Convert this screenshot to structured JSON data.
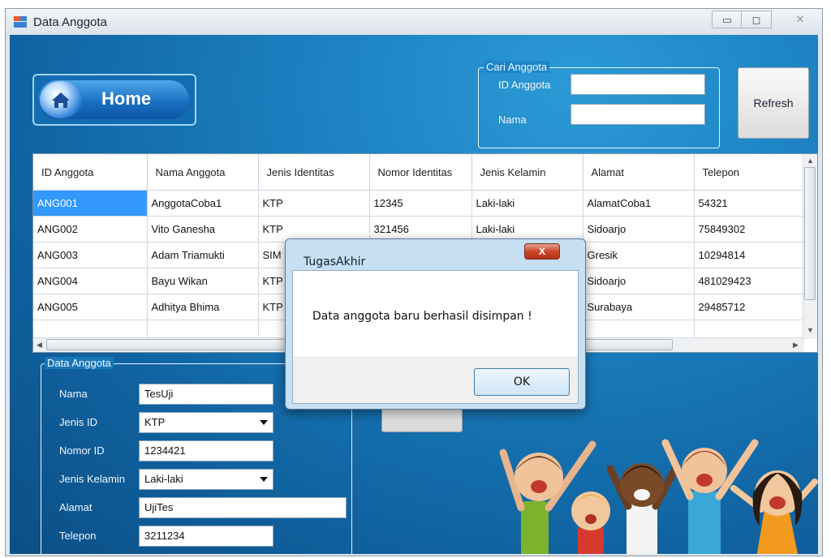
{
  "window": {
    "title": "Data Anggota",
    "controls": {
      "minimize": "▭",
      "maximize": "◻",
      "close": "✕"
    }
  },
  "home": {
    "label": "Home"
  },
  "search": {
    "group_title": "Cari Anggota",
    "id_label": "ID Anggota",
    "name_label": "Nama",
    "id_value": "",
    "name_value": ""
  },
  "refresh": {
    "label": "Refresh"
  },
  "grid": {
    "columns": [
      "ID Anggota",
      "Nama Anggota",
      "Jenis Identitas",
      "Nomor Identitas",
      "Jenis Kelamin",
      "Alamat",
      "Telepon"
    ],
    "rows": [
      [
        "ANG001",
        "AnggotaCoba1",
        "KTP",
        "12345",
        "Laki-laki",
        "AlamatCoba1",
        "54321"
      ],
      [
        "ANG002",
        "Vito Ganesha",
        "KTP",
        "321456",
        "Laki-laki",
        "Sidoarjo",
        "75849302"
      ],
      [
        "ANG003",
        "Adam Triamukti",
        "SIM",
        "",
        "",
        "Gresik",
        "10294814"
      ],
      [
        "ANG004",
        "Bayu Wikan",
        "KTP",
        "",
        "",
        "Sidoarjo",
        "481029423"
      ],
      [
        "ANG005",
        "Adhitya Bhima",
        "KTP",
        "",
        "",
        "Surabaya",
        "29485712"
      ]
    ]
  },
  "form": {
    "group_title": "Data Anggota",
    "nama_label": "Nama",
    "nama_value": "TesUji",
    "jenis_id_label": "Jenis ID",
    "jenis_id_value": "KTP",
    "nomor_id_label": "Nomor ID",
    "nomor_id_value": "1234421",
    "jenis_kelamin_label": "Jenis Kelamin",
    "jenis_kelamin_value": "Laki-laki",
    "alamat_label": "Alamat",
    "alamat_value": "UjiTes",
    "telepon_label": "Telepon",
    "telepon_value": "3211234"
  },
  "dialog": {
    "title": "TugasAkhir",
    "close": "X",
    "message": "Data anggota baru berhasil disimpan !",
    "ok": "OK"
  },
  "colors": {
    "accent": "#1b7fbf",
    "selection": "#3399ff",
    "close": "#c9492b"
  }
}
